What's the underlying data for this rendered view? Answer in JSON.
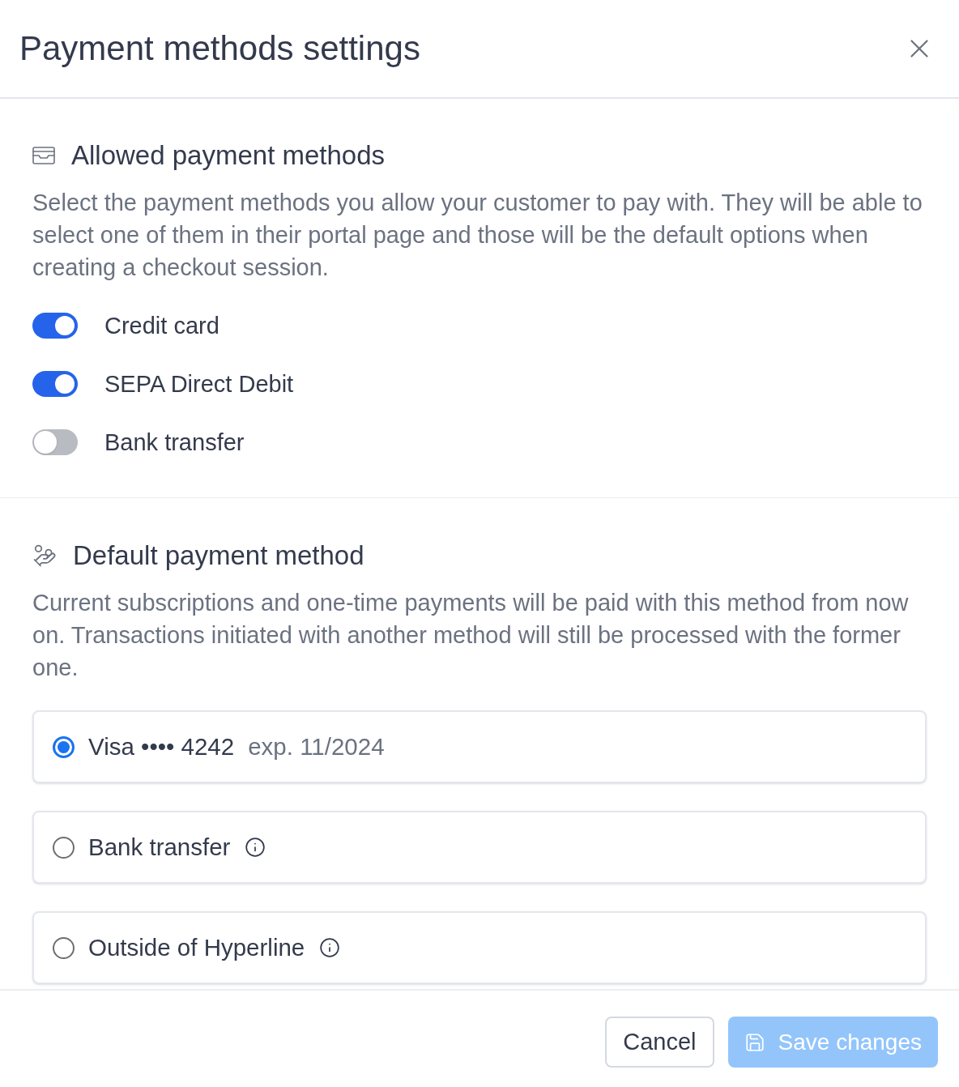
{
  "dialog": {
    "title": "Payment methods settings"
  },
  "allowed_section": {
    "heading": "Allowed payment methods",
    "description": "Select the payment methods you allow your customer to pay with. They will be able to select one of them in their portal page and those will be the default options when creating a checkout session.",
    "methods": [
      {
        "label": "Credit card",
        "on": true
      },
      {
        "label": "SEPA Direct Debit",
        "on": true
      },
      {
        "label": "Bank transfer",
        "on": false
      }
    ]
  },
  "default_section": {
    "heading": "Default payment method",
    "description": "Current subscriptions and one-time payments will be paid with this method from now on. Transactions initiated with another method will still be processed with the former one.",
    "options": [
      {
        "kind": "card",
        "label": "Visa •••• 4242",
        "detail": "exp. 11/2024",
        "selected": true
      },
      {
        "kind": "method",
        "label": "Bank transfer",
        "selected": false
      },
      {
        "kind": "method",
        "label": "Outside of Hyperline",
        "selected": false
      }
    ]
  },
  "footer": {
    "cancel": "Cancel",
    "save": {
      "label": "Save changes",
      "disabled": true
    }
  }
}
